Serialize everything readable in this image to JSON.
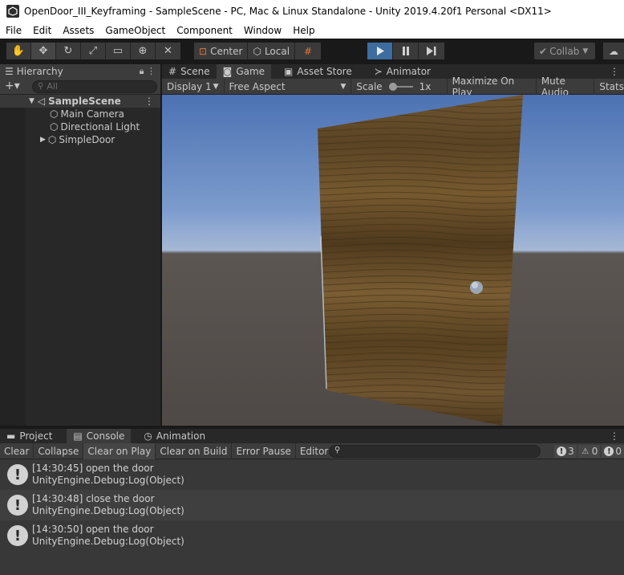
{
  "window": {
    "title": "OpenDoor_III_Keyframing - SampleScene - PC, Mac & Linux Standalone - Unity 2019.4.20f1 Personal <DX11>"
  },
  "menu": [
    "File",
    "Edit",
    "Assets",
    "GameObject",
    "Component",
    "Window",
    "Help"
  ],
  "toolbar": {
    "pivot_label": "Center",
    "space_label": "Local",
    "collab_label": "Collab"
  },
  "hierarchy": {
    "tab_label": "Hierarchy",
    "search_placeholder": "All",
    "scene_name": "SampleScene",
    "items": [
      {
        "label": "Main Camera"
      },
      {
        "label": "Directional Light"
      },
      {
        "label": "SimpleDoor"
      }
    ]
  },
  "view_tabs": [
    {
      "label": "Scene",
      "icon": "grid-icon"
    },
    {
      "label": "Game",
      "icon": "gamepad-icon",
      "active": true
    },
    {
      "label": "Asset Store",
      "icon": "bag-icon"
    },
    {
      "label": "Animator",
      "icon": "animator-icon"
    }
  ],
  "game_toolbar": {
    "display": "Display 1",
    "aspect": "Free Aspect",
    "scale_label": "Scale",
    "scale_value": "1x",
    "maximize": "Maximize On Play",
    "mute": "Mute Audio",
    "stats": "Stats"
  },
  "bottom_tabs": [
    {
      "label": "Project",
      "icon": "folder-icon"
    },
    {
      "label": "Console",
      "icon": "console-icon",
      "active": true
    },
    {
      "label": "Animation",
      "icon": "clock-icon"
    }
  ],
  "console_toolbar": {
    "clear": "Clear",
    "collapse": "Collapse",
    "clear_on_play": "Clear on Play",
    "clear_on_build": "Clear on Build",
    "error_pause": "Error Pause",
    "editor": "Editor",
    "log_count": "3",
    "warn_count": "0",
    "error_count": "0"
  },
  "console_logs": [
    {
      "line1": "[14:30:45] open the door",
      "line2": "UnityEngine.Debug:Log(Object)"
    },
    {
      "line1": "[14:30:48] close the door",
      "line2": "UnityEngine.Debug:Log(Object)"
    },
    {
      "line1": "[14:30:50] open the door",
      "line2": "UnityEngine.Debug:Log(Object)"
    }
  ]
}
